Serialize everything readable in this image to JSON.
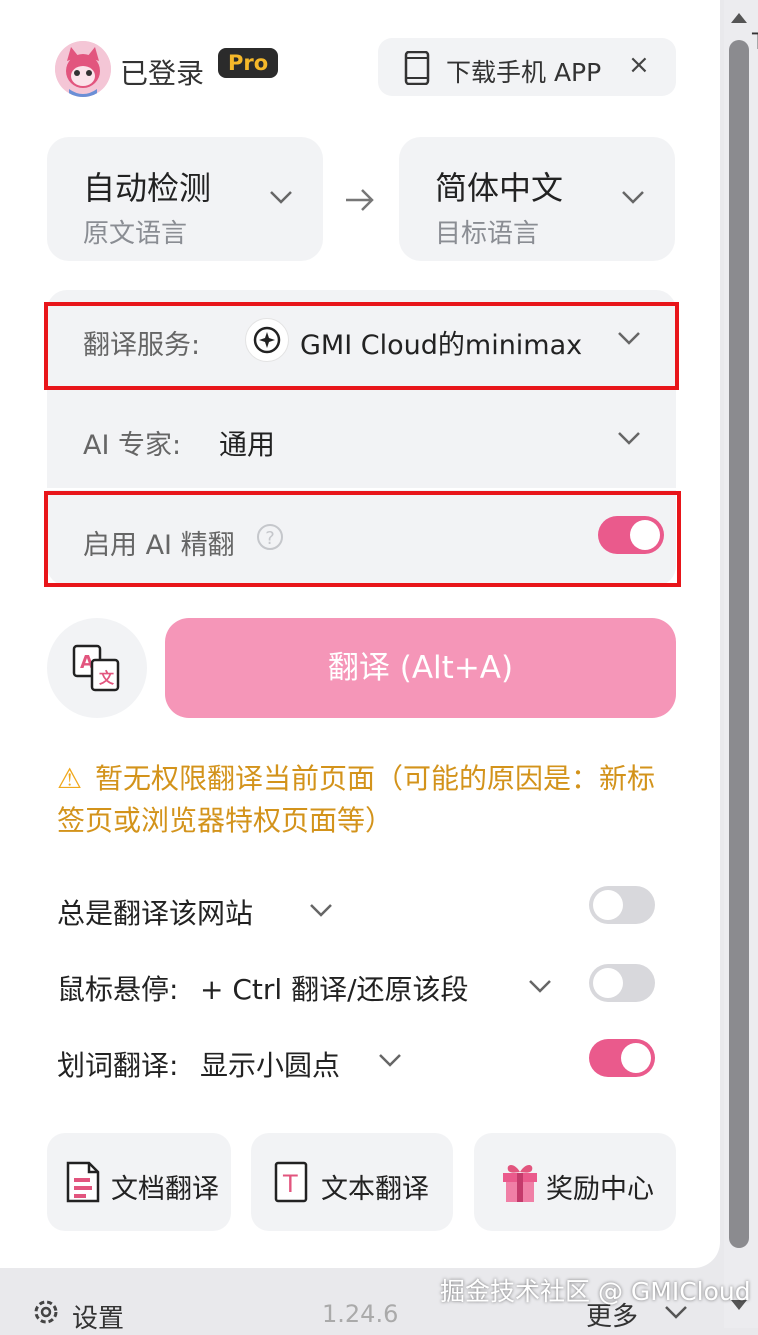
{
  "header": {
    "login_status": "已登录",
    "pro_badge": "Pro",
    "download_app": "下载手机 APP",
    "close_symbol": "×"
  },
  "languages": {
    "source": {
      "value": "自动检测",
      "caption": "原文语言"
    },
    "target": {
      "value": "简体中文",
      "caption": "目标语言"
    }
  },
  "settings": {
    "service_label": "翻译服务:",
    "service_value": "GMI Cloud的minimax",
    "expert_label": "AI 专家:",
    "expert_value": "通用",
    "ai_refine_label": "启用 AI 精翻",
    "ai_refine_help": "?",
    "ai_refine_enabled": true
  },
  "translate_button": "翻译 (Alt+A)",
  "warning": "暂无权限翻译当前页面（可能的原因是：新标签页或浏览器特权页面等）",
  "options": {
    "always_translate_label": "总是翻译该网站",
    "always_translate_enabled": false,
    "hover_label": "鼠标悬停:",
    "hover_value": "+ Ctrl 翻译/还原该段",
    "hover_enabled": false,
    "selection_label": "划词翻译:",
    "selection_value": "显示小圆点",
    "selection_enabled": true
  },
  "tools": {
    "doc_translate": "文档翻译",
    "text_translate": "文本翻译",
    "rewards": "奖励中心"
  },
  "footer": {
    "settings": "设置",
    "version": "1.24.6",
    "more": "更多"
  },
  "watermark": "掘金技术社区 @ GMICloud",
  "colors": {
    "accent_pink": "#ea5a8c",
    "translate_button_pink": "#f596b8",
    "warning_orange": "#d3931b",
    "highlight_red": "#e8151a",
    "pro_badge_gold": "#f5b82a"
  }
}
